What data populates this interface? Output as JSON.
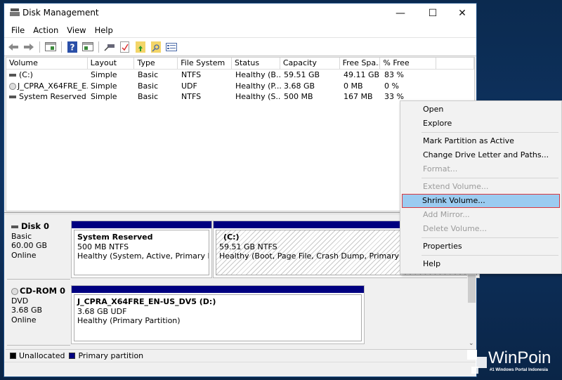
{
  "window": {
    "title": "Disk Management",
    "controls": {
      "minimize": "—",
      "maximize": "☐",
      "close": "✕"
    }
  },
  "menubar": [
    "File",
    "Action",
    "View",
    "Help"
  ],
  "toolbar": {
    "icons": [
      "back-arrow-icon",
      "forward-arrow-icon",
      "show-hide-console-tree-icon",
      "help-icon",
      "show-hide-action-pane-icon",
      "connect-disk-icon",
      "check-properties-icon",
      "folder-up-icon",
      "folder-search-icon",
      "list-view-icon"
    ]
  },
  "volume_list": {
    "columns": [
      "Volume",
      "Layout",
      "Type",
      "File System",
      "Status",
      "Capacity",
      "Free Spa...",
      "% Free",
      ""
    ],
    "rows": [
      {
        "icon": "drive",
        "volume": "(C:)",
        "layout": "Simple",
        "type": "Basic",
        "fs": "NTFS",
        "status": "Healthy (B...",
        "capacity": "59.51 GB",
        "free": "49.11 GB",
        "pct": "83 %"
      },
      {
        "icon": "cdrom",
        "volume": "J_CPRA_X64FRE_E...",
        "layout": "Simple",
        "type": "Basic",
        "fs": "UDF",
        "status": "Healthy (P...",
        "capacity": "3.68 GB",
        "free": "0 MB",
        "pct": "0 %"
      },
      {
        "icon": "drive",
        "volume": "System Reserved",
        "layout": "Simple",
        "type": "Basic",
        "fs": "NTFS",
        "status": "Healthy (S...",
        "capacity": "500 MB",
        "free": "167 MB",
        "pct": "33 %"
      }
    ]
  },
  "disks": [
    {
      "name": "Disk 0",
      "kind": "Basic",
      "size": "60.00 GB",
      "state": "Online",
      "partitions": [
        {
          "title": "System Reserved",
          "size_fs": "500 MB NTFS",
          "status": "Healthy (System, Active, Primary Partition)"
        },
        {
          "title": "(C:)",
          "size_fs": "59.51 GB NTFS",
          "status": "Healthy (Boot, Page File, Crash Dump, Primary Partition)"
        }
      ]
    },
    {
      "name": "CD-ROM 0",
      "kind": "DVD",
      "size": "3.68 GB",
      "state": "Online",
      "partitions": [
        {
          "title": "J_CPRA_X64FRE_EN-US_DV5  (D:)",
          "size_fs": "3.68 GB UDF",
          "status": "Healthy (Primary Partition)"
        }
      ]
    }
  ],
  "legend": [
    {
      "label": "Unallocated",
      "color": "#000000"
    },
    {
      "label": "Primary partition",
      "color": "#000080"
    }
  ],
  "context_menu": {
    "items": [
      {
        "label": "Open",
        "enabled": true
      },
      {
        "label": "Explore",
        "enabled": true
      },
      {
        "label": "Mark Partition as Active",
        "enabled": true
      },
      {
        "label": "Change Drive Letter and Paths...",
        "enabled": true
      },
      {
        "label": "Format...",
        "enabled": false
      },
      {
        "label": "Extend Volume...",
        "enabled": false
      },
      {
        "label": "Shrink Volume...",
        "enabled": true,
        "highlighted": true
      },
      {
        "label": "Add Mirror...",
        "enabled": false
      },
      {
        "label": "Delete Volume...",
        "enabled": false
      },
      {
        "label": "Properties",
        "enabled": true
      },
      {
        "label": "Help",
        "enabled": true
      }
    ]
  },
  "watermark": {
    "brand": "WinPoin",
    "tagline": "#1 Windows Portal Indonesia"
  },
  "colors": {
    "primary_partition": "#000080",
    "highlight": "#9bcbf0",
    "highlight_border": "#d9383f"
  }
}
